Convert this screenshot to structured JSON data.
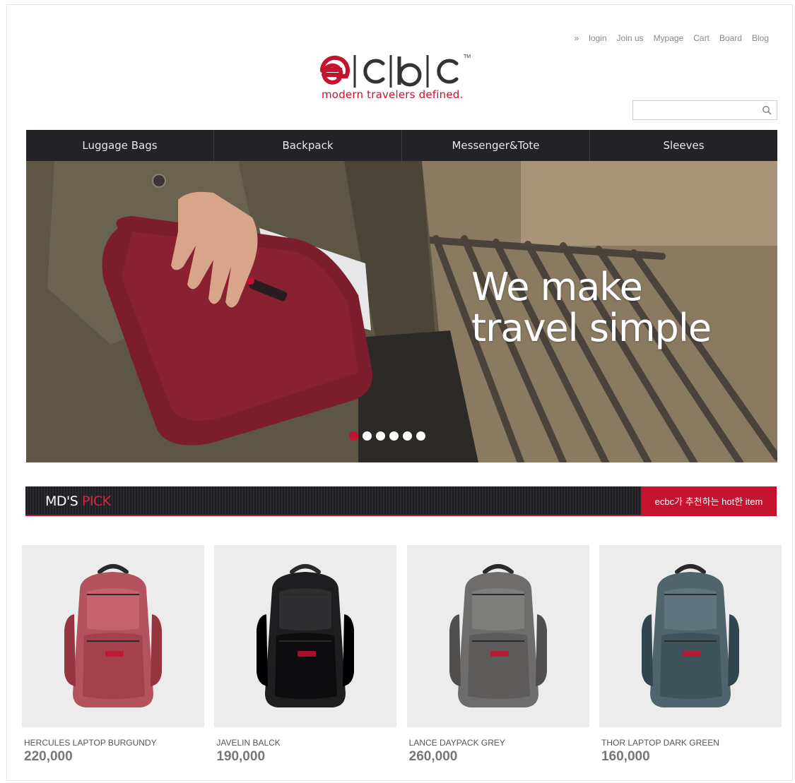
{
  "top_links": {
    "arrow": "»",
    "items": [
      "login",
      "Join us",
      "Mypage",
      "Cart",
      "Board",
      "Blog"
    ]
  },
  "logo": {
    "brand": "ecbc",
    "tagline": "modern travelers defined."
  },
  "search": {
    "placeholder": "",
    "icon": "search-icon"
  },
  "nav": {
    "items": [
      "Luggage Bags",
      "Backpack",
      "Messenger&Tote",
      "Sleeves"
    ]
  },
  "hero": {
    "line1": "We make",
    "line2": "travel simple",
    "slide_count": 6,
    "active_slide": 1
  },
  "md_pick": {
    "title_main": "MD'S",
    "title_accent": "PICK",
    "badge": "ecbc가 추천하는 hot한 item"
  },
  "products": [
    {
      "name": "HERCULES LAPTOP BURGUNDY",
      "price": "220,000",
      "color": "#b4525d"
    },
    {
      "name": "JAVELIN BALCK",
      "price": "190,000",
      "color": "#1e1e20"
    },
    {
      "name": "LANCE DAYPACK GREY",
      "price": "260,000",
      "color": "#6e6d6c"
    },
    {
      "name": "THOR LAPTOP DARK GREEN",
      "price": "160,000",
      "color": "#4f646d"
    }
  ],
  "colors": {
    "accent": "#c4122f",
    "nav_bg": "#232226"
  }
}
